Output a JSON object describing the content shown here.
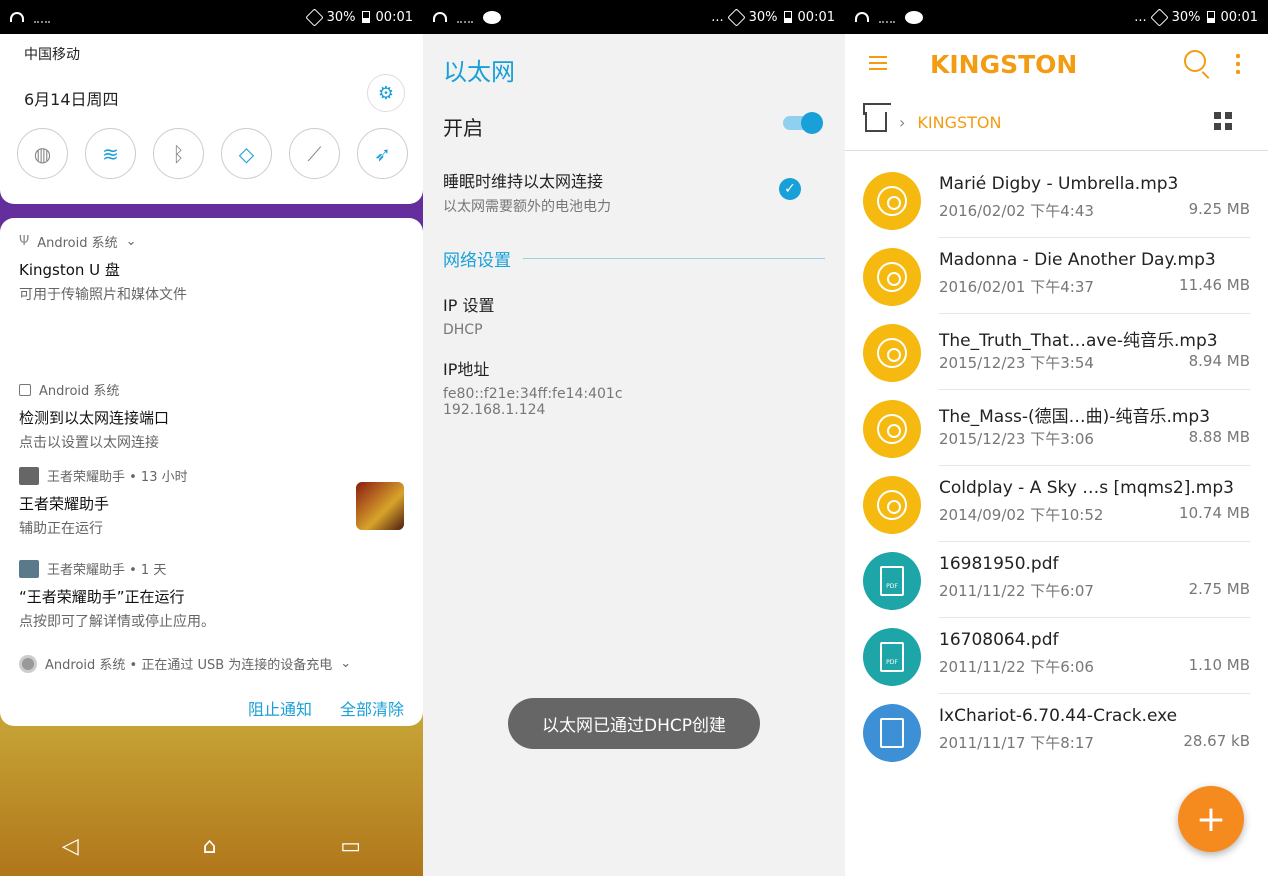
{
  "status": {
    "battery": "30%",
    "time": "00:01",
    "dots": "..."
  },
  "notification_shade": {
    "carrier": "中国移动",
    "date": "6月14日周四",
    "notifications": [
      {
        "app": "Android 系统",
        "title": "Kingston U 盘",
        "desc": "可用于传输照片和媒体文件"
      },
      {
        "app": "Android 系统",
        "title": "检测到以太网连接端口",
        "desc": "点击以设置以太网连接"
      },
      {
        "app": "王者荣耀助手 • 13 小时",
        "title": "王者荣耀助手",
        "desc": "辅助正在运行"
      },
      {
        "app": "王者荣耀助手 • 1 天",
        "title": "“王者荣耀助手”正在运行",
        "desc": "点按即可了解详情或停止应用。"
      },
      {
        "app": "Android 系统 • 正在通过 USB 为连接的设备充电"
      }
    ],
    "actions": {
      "block": "阻止通知",
      "clear": "全部清除"
    }
  },
  "ethernet": {
    "title": "以太网",
    "enable_label": "开启",
    "sleep_title": "睡眠时维持以太网连接",
    "sleep_desc": "以太网需要额外的电池电力",
    "section": "网络设置",
    "ip_setting_label": "IP 设置",
    "ip_setting_value": "DHCP",
    "ip_addr_label": "IP地址",
    "ip_v6": "fe80::f21e:34ff:fe14:401c",
    "ip_v4": "192.168.1.124",
    "toast": "以太网已通过DHCP创建"
  },
  "file_manager": {
    "title": "KINGSTON",
    "breadcrumb": "KINGSTON",
    "files": [
      {
        "name": "Marié Digby - Umbrella.mp3",
        "date": "2016/02/02 下午4:43",
        "size": "9.25 MB",
        "type": "music"
      },
      {
        "name": "Madonna - Die Another Day.mp3",
        "date": "2016/02/01 下午4:37",
        "size": "11.46 MB",
        "type": "music"
      },
      {
        "name": "The_Truth_That…ave-纯音乐.mp3",
        "date": "2015/12/23 下午3:54",
        "size": "8.94 MB",
        "type": "music"
      },
      {
        "name": "The_Mass-(德国…曲)-纯音乐.mp3",
        "date": "2015/12/23 下午3:06",
        "size": "8.88 MB",
        "type": "music"
      },
      {
        "name": "Coldplay - A Sky …s [mqms2].mp3",
        "date": "2014/09/02 下午10:52",
        "size": "10.74 MB",
        "type": "music"
      },
      {
        "name": "16981950.pdf",
        "date": "2011/11/22 下午6:07",
        "size": "2.75 MB",
        "type": "pdf"
      },
      {
        "name": "16708064.pdf",
        "date": "2011/11/22 下午6:06",
        "size": "1.10 MB",
        "type": "pdf"
      },
      {
        "name": "IxChariot-6.70.44-Crack.exe",
        "date": "2011/11/17 下午8:17",
        "size": "28.67 kB",
        "type": "exe"
      }
    ],
    "pdf_label": "PDF"
  }
}
